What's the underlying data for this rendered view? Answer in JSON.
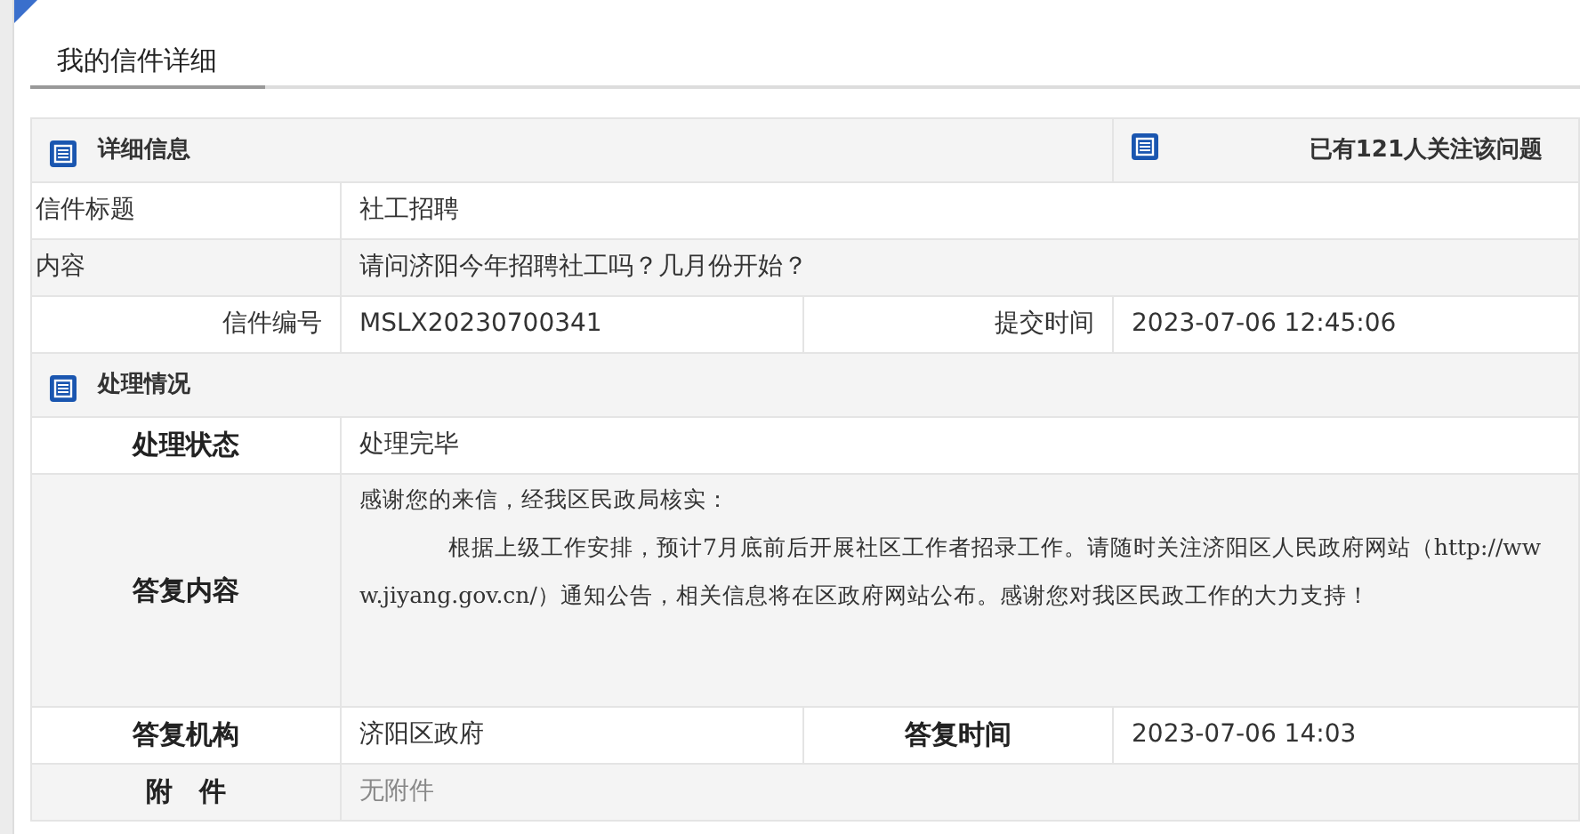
{
  "page_tab": {
    "label": "我的信件详细",
    "selected": true
  },
  "detail_section": {
    "title": "详细信息",
    "follow_count_text": "已有121人关注该问题"
  },
  "letter_rows": [
    {
      "kind": "wide",
      "label": "信件标题",
      "value": "社工招聘"
    },
    {
      "kind": "wide",
      "label": "内容",
      "value": "请问济阳今年招聘社工吗？几月份开始？"
    },
    {
      "kind": "pair",
      "label": "信件编号",
      "value": "MSLX20230700341",
      "label_2": "提交时间",
      "value_2": "2023-07-06 12:45:06"
    }
  ],
  "handling_section": {
    "title": "处理情况"
  },
  "handling_rows": [
    {
      "kind": "wide",
      "label": "处理状态",
      "value": "处理完毕"
    },
    {
      "kind": "reply",
      "label": "答复内容",
      "paragraphs": [
        "感谢您的来信，经我区民政局核实：",
        "根据上级工作安排，预计7月底前后开展社区工作者招录工作。请随时关注济阳区人民政府网站（http://www.jiyang.gov.cn/）通知公告，相关信息将在区政府网站公布。感谢您对我区民政工作的大力支持！"
      ]
    },
    {
      "kind": "pair",
      "label": "答复机构",
      "value": "济阳区政府",
      "label_2": "答复时间",
      "value_2": "2023-07-06 14:03"
    },
    {
      "kind": "muted",
      "label": "附　件",
      "value": "无附件"
    }
  ]
}
